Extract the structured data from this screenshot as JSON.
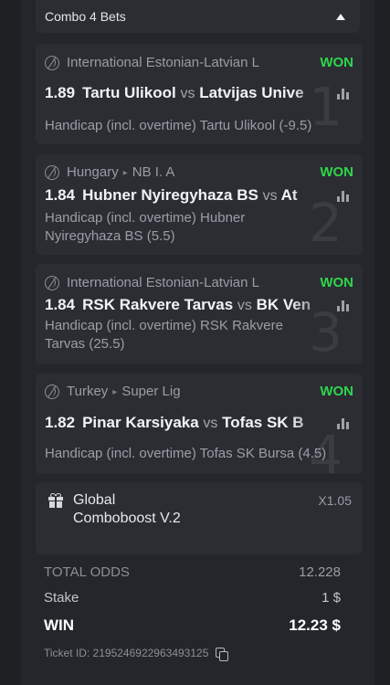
{
  "combo": {
    "title": "Combo 4 Bets"
  },
  "bets": [
    {
      "num": "1",
      "league": [
        "International Estonian-Latvian L"
      ],
      "status": "WON",
      "odd": "1.89",
      "home": "Tartu Ulikool",
      "vs": "vs",
      "away": "Latvijas Unive",
      "market": "Handicap (incl. overtime) Tartu Ulikool (-9.5)"
    },
    {
      "num": "2",
      "league": [
        "Hungary",
        "NB I. A"
      ],
      "status": "WON",
      "odd": "1.84",
      "home": "Hubner Nyiregyhaza BS",
      "vs": "vs",
      "away": "At",
      "market": "Handicap (incl. overtime) Hubner Nyiregyhaza BS (5.5)"
    },
    {
      "num": "3",
      "league": [
        "International Estonian-Latvian L"
      ],
      "status": "WON",
      "odd": "1.84",
      "home": "RSK Rakvere Tarvas",
      "vs": "vs",
      "away": "BK Ven",
      "market": "Handicap (incl. overtime) RSK Rakvere Tarvas (25.5)"
    },
    {
      "num": "4",
      "league": [
        "Turkey",
        "Super Lig"
      ],
      "status": "WON",
      "odd": "1.82",
      "home": "Pinar Karsiyaka",
      "vs": "vs",
      "away": "Tofas SK B",
      "market": "Handicap (incl. overtime) Tofas SK Bursa (4.5)"
    }
  ],
  "boost": {
    "name": "Global Comboboost V.2",
    "multiplier": "X1.05"
  },
  "summary": {
    "total_odds_label": "TOTAL ODDS",
    "total_odds": "12.228",
    "stake_label": "Stake",
    "stake": "1 $",
    "win_label": "WIN",
    "win": "12.23 $"
  },
  "ticket": {
    "text": "Ticket ID: 2195246922963493125"
  },
  "colors": {
    "won": "#2fd64b",
    "background": "#24262b",
    "card": "#2b2d33"
  }
}
